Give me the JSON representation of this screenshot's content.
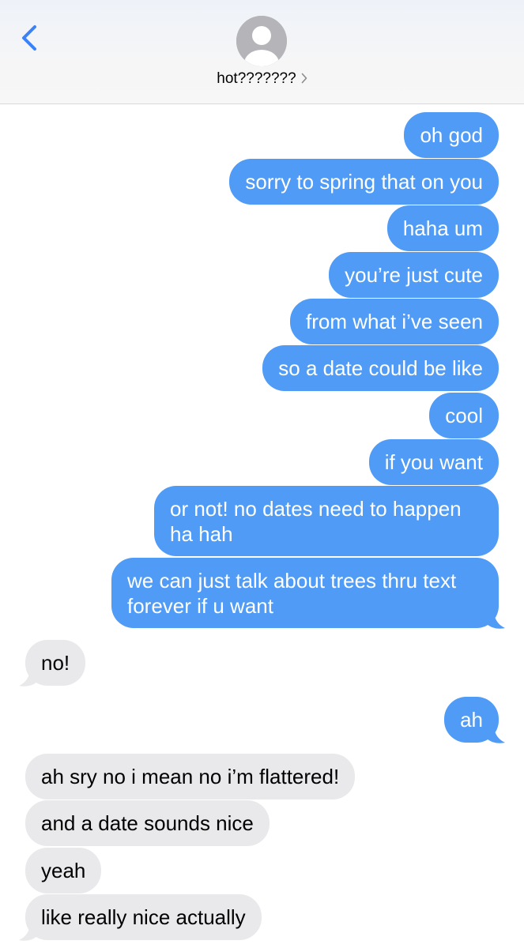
{
  "header": {
    "contact_name": "hot???????"
  },
  "colors": {
    "outgoing_bubble": "#4f9bf5",
    "incoming_bubble": "#e9e9eb",
    "accent": "#3a82f7"
  },
  "messages": [
    {
      "from": "me",
      "text": "oh god"
    },
    {
      "from": "me",
      "text": "sorry to spring that on you"
    },
    {
      "from": "me",
      "text": "haha um"
    },
    {
      "from": "me",
      "text": "you’re just cute"
    },
    {
      "from": "me",
      "text": "from what i’ve seen"
    },
    {
      "from": "me",
      "text": "so a date could be like"
    },
    {
      "from": "me",
      "text": "cool"
    },
    {
      "from": "me",
      "text": "if you want"
    },
    {
      "from": "me",
      "text": "or not! no dates need to happen ha hah"
    },
    {
      "from": "me",
      "text": "we can just talk about trees thru text forever if u want"
    },
    {
      "from": "them",
      "text": "no!"
    },
    {
      "from": "me",
      "text": "ah"
    },
    {
      "from": "them",
      "text": "ah sry no i mean no i’m flattered!"
    },
    {
      "from": "them",
      "text": "and a date sounds nice"
    },
    {
      "from": "them",
      "text": "yeah"
    },
    {
      "from": "them",
      "text": "like really nice actually"
    }
  ]
}
